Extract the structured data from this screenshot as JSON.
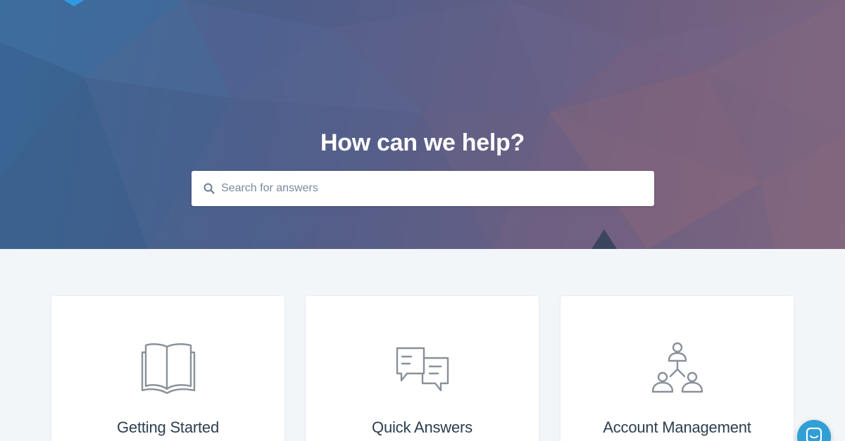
{
  "hero": {
    "title": "How can we help?"
  },
  "search": {
    "placeholder": "Search for answers",
    "value": "",
    "icon": "search-icon"
  },
  "categories": [
    {
      "title": "Getting Started",
      "icon": "book-icon"
    },
    {
      "title": "Quick Answers",
      "icon": "chat-bubbles-icon"
    },
    {
      "title": "Account Management",
      "icon": "team-hierarchy-icon"
    }
  ],
  "chat_launcher": {
    "icon": "chat-icon"
  },
  "colors": {
    "accent": "#2f9fd6",
    "icon_gray": "#8a9099",
    "text_dark": "#2c3e50",
    "page_bg": "#f3f6f9"
  }
}
